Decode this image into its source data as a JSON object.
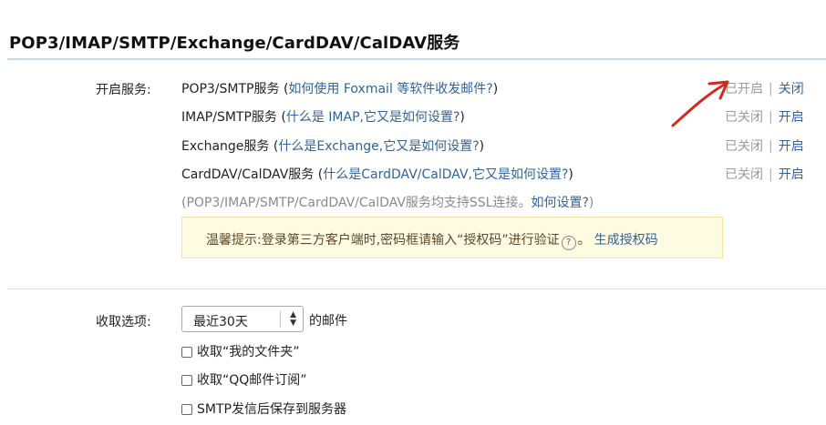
{
  "section_title": "POP3/IMAP/SMTP/Exchange/CardDAV/CalDAV服务",
  "services_label": "开启服务:",
  "services": [
    {
      "name": "POP3/SMTP服务",
      "link": "如何使用 Foxmail 等软件收发邮件?",
      "state": "已开启",
      "action": "关闭"
    },
    {
      "name": "IMAP/SMTP服务",
      "link": "什么是 IMAP,它又是如何设置?",
      "state": "已关闭",
      "action": "开启"
    },
    {
      "name": "Exchange服务",
      "link": "什么是Exchange,它又是如何设置?",
      "state": "已关闭",
      "action": "开启"
    },
    {
      "name": "CardDAV/CalDAV服务",
      "link": "什么是CardDAV/CalDAV,它又是如何设置?",
      "state": "已关闭",
      "action": "开启"
    }
  ],
  "separator": "|",
  "ssl_note": "(POP3/IMAP/SMTP/CardDAV/CalDAV服务均支持SSL连接。",
  "ssl_link": "如何设置?",
  "ssl_close": ")",
  "tip": {
    "text": "温馨提示:登录第三方客户端时,密码框请输入“授权码”进行验证",
    "help_icon_glyph": "?",
    "link": "生成授权码"
  },
  "fetch_label": "收取选项:",
  "fetch_select": {
    "value": "最近30天",
    "suffix": "的邮件"
  },
  "checkboxes": [
    {
      "label": "收取“我的文件夹”",
      "checked": false
    },
    {
      "label": "收取“QQ邮件订阅”",
      "checked": false
    },
    {
      "label": "SMTP发信后保存到服务器",
      "checked": false
    }
  ],
  "colors": {
    "link": "#31639c",
    "annotation_arrow": "#d42a1e"
  }
}
